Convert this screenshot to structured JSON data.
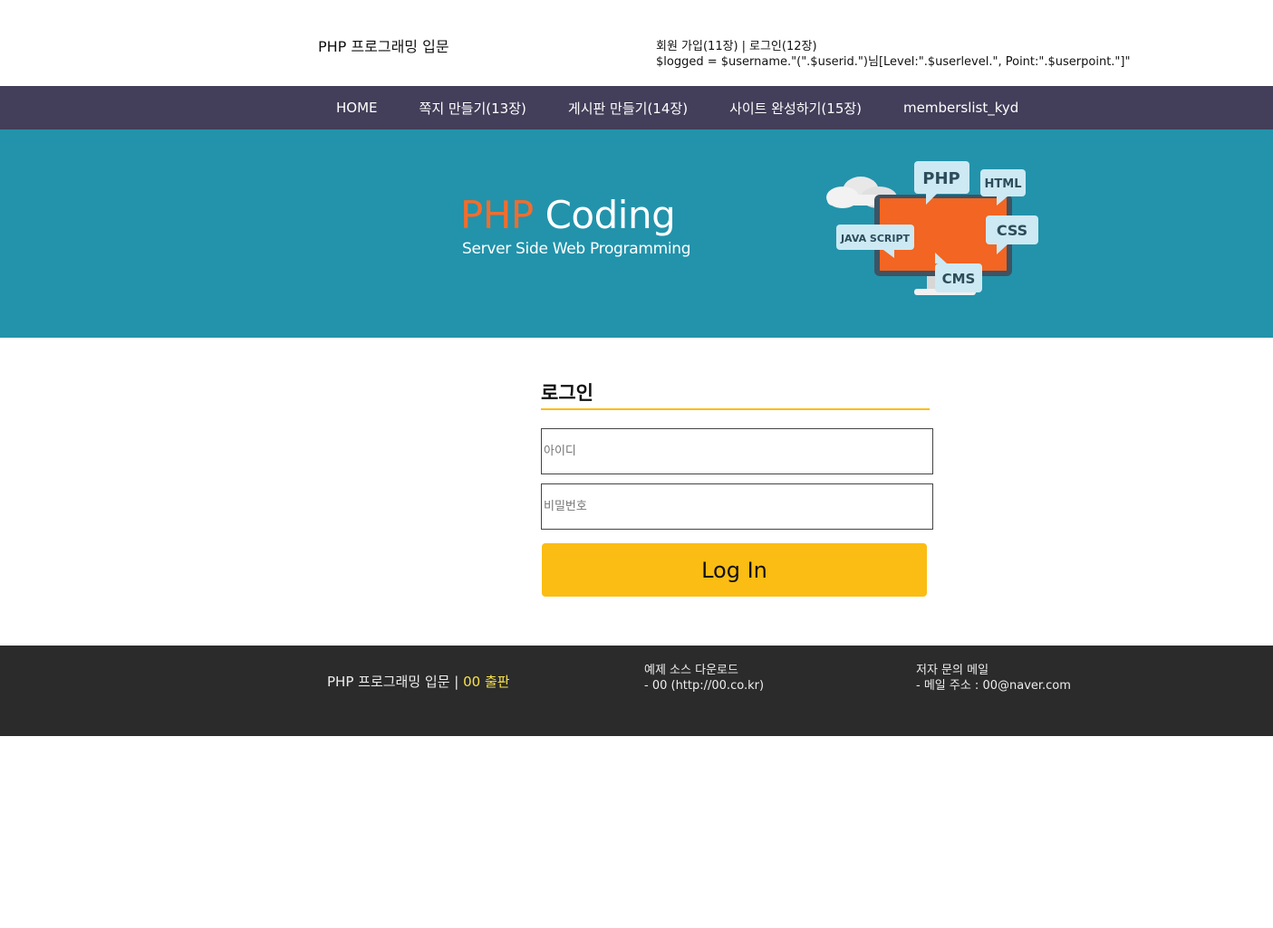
{
  "header": {
    "site_title": "PHP 프로그래밍 입문",
    "join_link": "회원 가입(11장)",
    "separator": "|",
    "login_link": "로그인(12장)",
    "logged_line": "$logged = $username.\"(\".$userid.\")님[Level:\".$userlevel.\", Point:\".$userpoint.\"]\""
  },
  "menu": [
    {
      "label": "HOME"
    },
    {
      "label": "쪽지 만들기(13장)"
    },
    {
      "label": "게시판 만들기(14장)"
    },
    {
      "label": "사이트 완성하기(15장)"
    },
    {
      "label": "memberslist_kyd"
    }
  ],
  "banner": {
    "title_php": "PHP",
    "title_rest": " Coding",
    "subtitle": "Server Side Web Programming",
    "bubble_php": "PHP",
    "bubble_html": "HTML",
    "bubble_css": "CSS",
    "bubble_js": "JAVA SCRIPT",
    "bubble_cms": "CMS"
  },
  "login": {
    "title": "로그인",
    "id_placeholder": "아이디",
    "pw_placeholder": "비밀번호",
    "button": "Log In"
  },
  "footer": {
    "brand": "PHP 프로그래밍 입문 ",
    "brand_sep": "|",
    "publisher": " 00 출판",
    "download_title": "예제 소스 다운로드",
    "download_detail": "- 00 (http://00.co.kr)",
    "mail_title": "저자 문의 메일",
    "mail_detail": "- 메일 주소 : 00@naver.com"
  },
  "colors": {
    "nav_bg": "#433e59",
    "banner_bg": "#2293ab",
    "accent": "#fbbd13",
    "footer_bg": "#2b2b2b",
    "publisher": "#f6e14d",
    "php_orange": "#f26d2d"
  }
}
